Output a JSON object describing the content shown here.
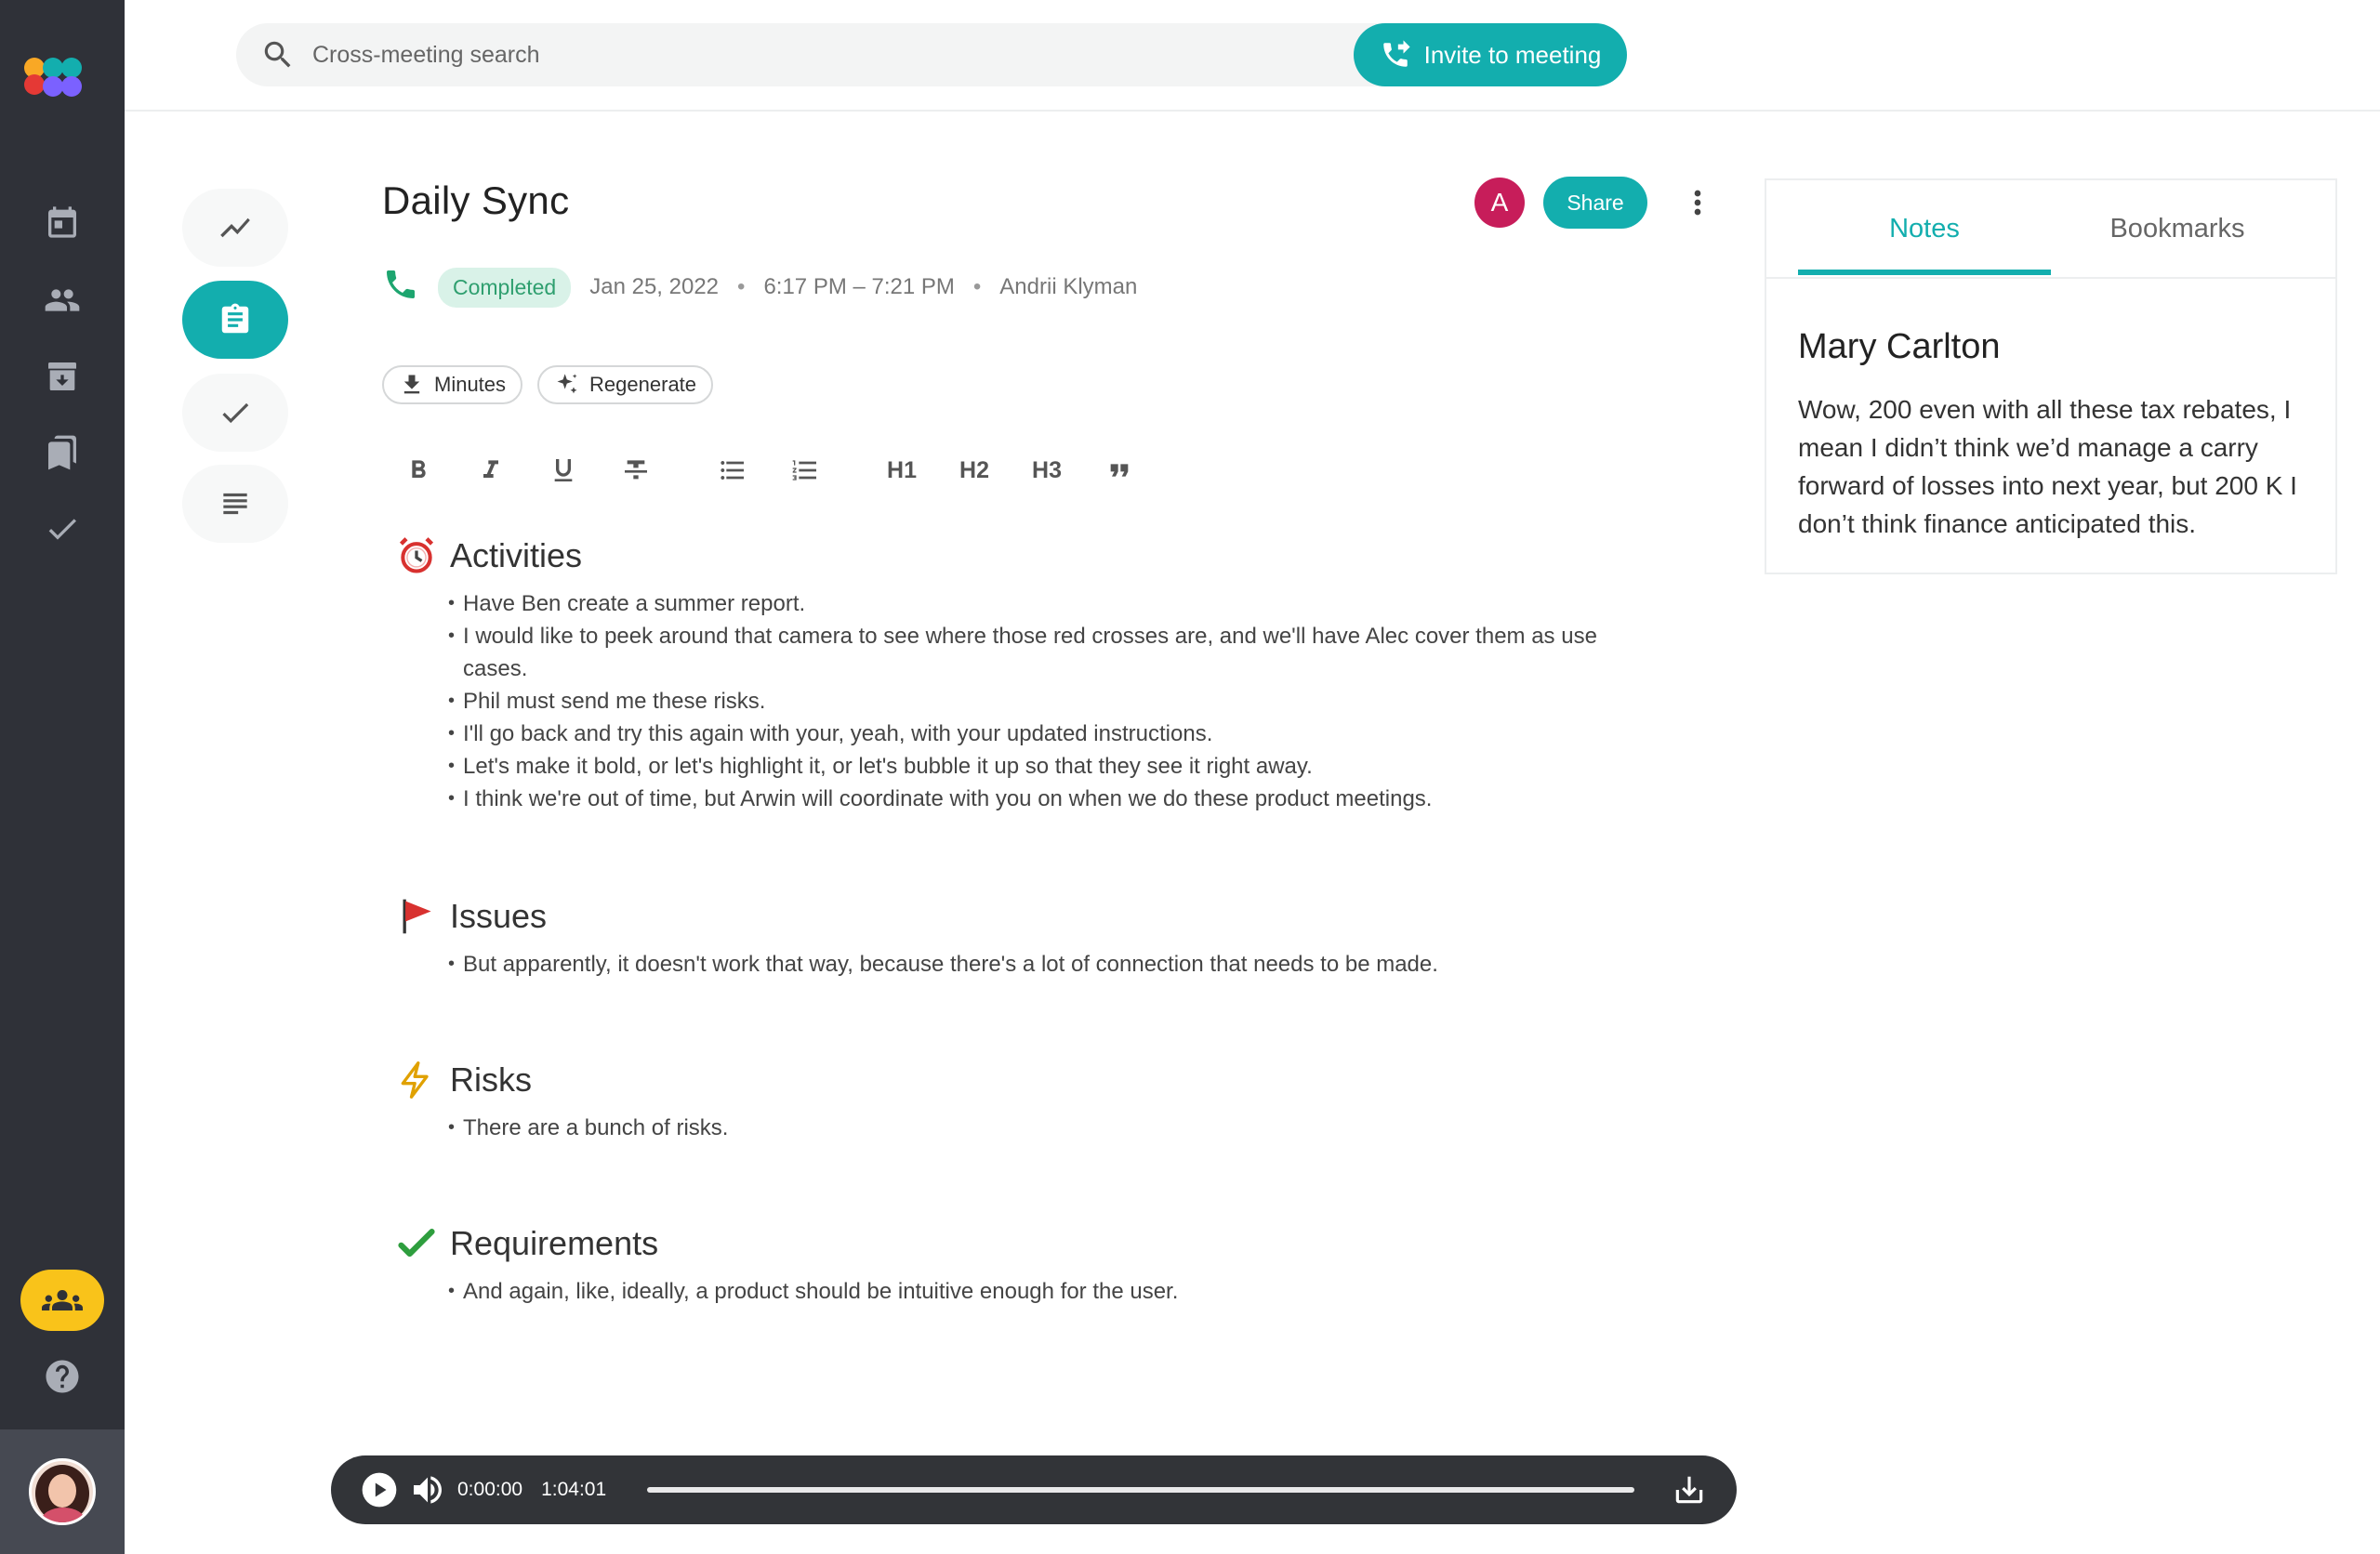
{
  "search": {
    "placeholder": "Cross-meeting search"
  },
  "invite": {
    "label": "Invite to meeting"
  },
  "meeting": {
    "title": "Daily Sync",
    "status": "Completed",
    "date": "Jan 25, 2022",
    "time_range": "6:17 PM – 7:21 PM",
    "organizer": "Andrii Klyman",
    "participant_initial": "A",
    "share_label": "Share"
  },
  "chips": {
    "minutes": "Minutes",
    "regenerate": "Regenerate"
  },
  "toolbar": {
    "h1": "H1",
    "h2": "H2",
    "h3": "H3"
  },
  "sections": [
    {
      "title": "Activities",
      "items": [
        "Have Ben create a summer report.",
        "I would like to peek around that camera to see where those red crosses are, and we'll have Alec cover them as use cases.",
        "Phil must send me these risks.",
        "I'll go back and try this again with your, yeah, with your updated instructions.",
        "Let's make it bold, or let's highlight it, or let's bubble it up so that they see it right away.",
        "I think we're out of time, but Arwin will coordinate with you on when we do these product meetings."
      ]
    },
    {
      "title": "Issues",
      "items": [
        "But apparently, it doesn't work that way, because there's a lot of connection that needs to be made."
      ]
    },
    {
      "title": "Risks",
      "items": [
        "There are a bunch of risks."
      ]
    },
    {
      "title": "Requirements",
      "items": [
        "And again, like, ideally, a product should be intuitive enough for the user."
      ]
    }
  ],
  "panel": {
    "tabs": [
      "Notes",
      "Bookmarks"
    ],
    "active_tab": "Notes",
    "note_author": "Mary Carlton",
    "note_text": "Wow, 200 even with all these tax rebates, I mean I didn’t think we’d manage a carry forward of losses into next year, but 200 K I don’t think finance anticipated this."
  },
  "player": {
    "current_time": "0:00:00",
    "duration": "1:04:01",
    "progress": 0
  },
  "colors": {
    "accent": "#13aeae",
    "sidebar": "#2f3138",
    "team_button": "#f9c31a",
    "participant": "#c71d5a",
    "completed_bg": "#d9f2e8",
    "completed_text": "#2f9f6f"
  },
  "icons": {
    "sidebar": [
      "calendar-icon",
      "people-icon",
      "archive-icon",
      "bookmarks-icon",
      "check-icon"
    ],
    "rail": [
      "analytics-icon",
      "notes-clipboard-icon",
      "tasks-check-icon",
      "transcript-icon"
    ],
    "sections": [
      "alarm-clock-icon",
      "red-flag-icon",
      "lightning-icon",
      "green-check-icon"
    ]
  }
}
